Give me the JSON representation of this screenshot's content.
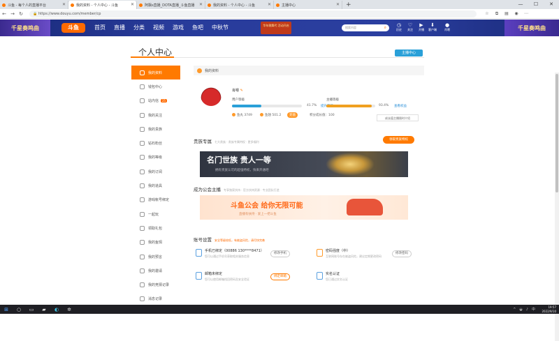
{
  "browser": {
    "tabs": [
      {
        "title": "斗鱼 - 每个人的直播平台",
        "active": false
      },
      {
        "title": "我的资料 - 个人中心 - 斗鱼",
        "active": true
      },
      {
        "title": "阿飘s直播_DOTA直播_斗鱼直播",
        "active": false
      },
      {
        "title": "我的资料 - 个人中心 - 斗鱼",
        "active": false
      },
      {
        "title": "主播中心",
        "active": false
      }
    ],
    "url": "https://www.douyu.com/member/cp"
  },
  "topnav": {
    "banner_left": "千星奏鸣曲",
    "logo": "斗鱼",
    "items": [
      "首页",
      "直播",
      "分类",
      "视频",
      "游戏",
      "鱼吧",
      "中秋节"
    ],
    "recruit": "华年歌舞代 活动开启",
    "search_placeholder": "搜索内容",
    "icons": [
      {
        "icon": "history-icon",
        "label": "历史"
      },
      {
        "icon": "follow-icon",
        "label": "关注"
      },
      {
        "icon": "live-icon",
        "label": "开播"
      },
      {
        "icon": "download-icon",
        "label": "客户端"
      }
    ],
    "username": "肖嗯",
    "banner_right": "千星奏鸣曲"
  },
  "page": {
    "title": "个人中心",
    "anchor_button": "主播中心"
  },
  "sidebar": {
    "items": [
      {
        "label": "我的资料",
        "active": true
      },
      {
        "label": "钱包中心"
      },
      {
        "label": "站内信",
        "badge": "25"
      },
      {
        "label": "我的关注"
      },
      {
        "label": "我的贵族"
      },
      {
        "label": "钻石粉丝"
      },
      {
        "label": "我的等级"
      },
      {
        "label": "我的订阅"
      },
      {
        "label": "我的道具"
      },
      {
        "label": "游戏帐号绑定"
      },
      {
        "label": "一起玩"
      },
      {
        "label": "领取礼包"
      },
      {
        "label": "我的鱼饵"
      },
      {
        "label": "我的预言"
      },
      {
        "label": "我的邀请"
      },
      {
        "label": "我的竞猜记录"
      },
      {
        "label": "消息记录"
      }
    ]
  },
  "profile": {
    "section": "我的资料",
    "username": "肖嗯",
    "user_level_label": "用户等级",
    "user_level_value": 0.417,
    "user_level_pct": "41.7%",
    "user_level_link": "提升等级",
    "anchor_level_label": "主播等级",
    "anchor_level_value": 0.934,
    "anchor_level_pct": "93.4%",
    "anchor_level_link": "查看权益",
    "fishball": "鱼丸 3749",
    "fishwing": "鱼翅 501.2",
    "recharge": "充值",
    "vip_progress": "积分成长值：100",
    "tooltip": "成长值主播限时介绍"
  },
  "noble": {
    "title": "贵族专属",
    "subtitle": "七大贵族 · 贵族专属特权 · 更多福利",
    "button": "领取贵族特权",
    "banner_title": "名门世族 贵人一等",
    "banner_sub": "拥有贵族认可的超强特权，快来开通吧"
  },
  "guild": {
    "title": "成为公会主播",
    "subtitle": "专享独家扶持 · 官方扶持资源 · 专业团队打造",
    "banner_title": "斗鱼公会 给你无限可能",
    "banner_sub": "直播有扶持 · 爱上一把斗鱼"
  },
  "account": {
    "title": "账号设置",
    "note": "安全等级较低，有被盗风险，请尽快完善",
    "phone_title": "手机已绑定（00886 130****8471）",
    "phone_desc": "您可以通过手机号获取相关服务信息",
    "phone_btn": "修改手机",
    "password_title": "密码强度（中）",
    "password_desc": "互联网账号存在被盗风险，建议定期更改密码",
    "password_btn": "修改密码",
    "email_title": "邮箱未绑定",
    "email_desc": "您可以使用邮箱找回密码及安全验证",
    "email_btn": "绑定邮箱",
    "realname_title": "实名认证",
    "realname_desc": "您已通过实名认证"
  },
  "taskbar": {
    "time": "19:57",
    "date": "2022/9/10"
  }
}
